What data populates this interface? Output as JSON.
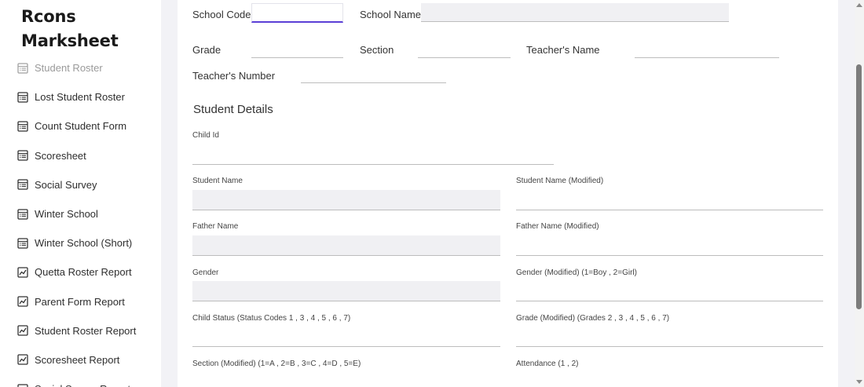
{
  "brand": {
    "line1": "Rcons",
    "line2": "Marksheet"
  },
  "sidebar": {
    "items": [
      {
        "label": "Student Roster",
        "icon": "table-icon",
        "faded": true
      },
      {
        "label": "Lost Student Roster",
        "icon": "table-icon"
      },
      {
        "label": "Count Student Form",
        "icon": "table-icon"
      },
      {
        "label": "Scoresheet",
        "icon": "table-icon"
      },
      {
        "label": "Social Survey",
        "icon": "table-icon"
      },
      {
        "label": "Winter School",
        "icon": "table-icon"
      },
      {
        "label": "Winter School (Short)",
        "icon": "table-icon"
      },
      {
        "label": "Quetta Roster Report",
        "icon": "chart-icon"
      },
      {
        "label": "Parent Form Report",
        "icon": "chart-icon"
      },
      {
        "label": "Student Roster Report",
        "icon": "chart-icon"
      },
      {
        "label": "Scoresheet Report",
        "icon": "chart-icon"
      },
      {
        "label": "Social Survey Report",
        "icon": "chart-icon"
      }
    ]
  },
  "form": {
    "school_code_label": "School Code",
    "school_code_value": "",
    "school_name_label": "School Name",
    "school_name_value": "",
    "grade_label": "Grade",
    "section_label": "Section",
    "teacher_name_label": "Teacher's Name",
    "teacher_number_label": "Teacher's Number",
    "student_details_title": "Student Details",
    "child_id_label": "Child Id",
    "student_name_label": "Student Name",
    "student_name_modified_label": "Student Name (Modified)",
    "father_name_label": "Father Name",
    "father_name_modified_label": "Father Name (Modified)",
    "gender_label": "Gender",
    "gender_modified_label": "Gender (Modified) (1=Boy , 2=Girl)",
    "child_status_label": "Child Status (Status Codes 1 , 3 , 4 , 5 , 6 , 7)",
    "grade_modified_label": "Grade (Modified) (Grades 2 , 3 , 4 , 5 , 6 , 7)",
    "section_modified_label": "Section (Modified) (1=A , 2=B , 3=C , 4=D , 5=E)",
    "attendance_label": "Attendance (1 , 2)"
  },
  "colors": {
    "accent": "#5b3fd6",
    "background": "#f2f2f6",
    "panel": "#ffffff"
  }
}
